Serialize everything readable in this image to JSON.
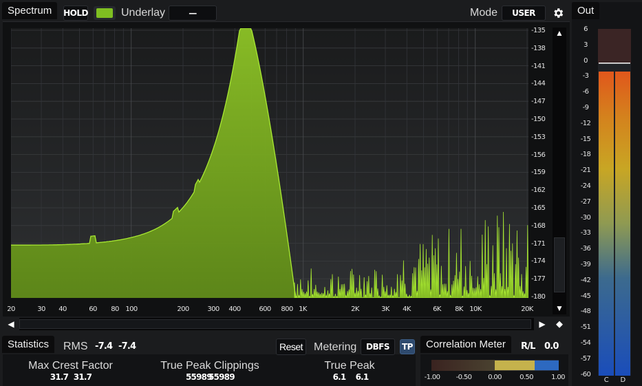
{
  "spectrum": {
    "tab": "Spectrum",
    "hold_label": "HOLD",
    "hold_toggle_color": "#7fbf21",
    "underlay_label": "Underlay",
    "underlay_value": "—",
    "mode_label": "Mode",
    "mode_value": "USER",
    "settings_icon": "gear-icon",
    "y_ticks": [
      "-135",
      "-138",
      "-141",
      "-144",
      "-147",
      "-150",
      "-153",
      "-156",
      "-159",
      "-162",
      "-165",
      "-168",
      "-171",
      "-174",
      "-177",
      "-180"
    ],
    "x_ticks": [
      "20",
      "30",
      "40",
      "60",
      "80",
      "100",
      "200",
      "300",
      "400",
      "600",
      "800",
      "1K",
      "2K",
      "3K",
      "4K",
      "6K",
      "8K",
      "10K",
      "20K"
    ],
    "fill_color": "#7fb521",
    "line_color": "#a8e832"
  },
  "out": {
    "tab": "Out",
    "ticks": [
      "6",
      "3",
      "0",
      "-3",
      "-6",
      "-9",
      "-12",
      "-15",
      "-18",
      "-21",
      "-24",
      "-27",
      "-30",
      "-33",
      "-36",
      "-39",
      "-42",
      "-45",
      "-48",
      "-51",
      "-54",
      "-57",
      "-60"
    ],
    "channels": [
      "C",
      "D"
    ]
  },
  "statistics": {
    "tab": "Statistics",
    "rms_label": "RMS",
    "rms_left": "-7.4",
    "rms_right": "-7.4",
    "reset_label": "Reset",
    "metering_label": "Metering",
    "metering_value": "DBFS",
    "tp_label": "TP",
    "max_crest_label": "Max Crest Factor",
    "max_crest_left": "31.7",
    "max_crest_right": "31.7",
    "clippings_label": "True Peak Clippings",
    "clippings_left": "55989",
    "clippings_right": "55989",
    "true_peak_label": "True Peak",
    "true_peak_left": "6.1",
    "true_peak_right": "6.1"
  },
  "correlation": {
    "tab": "Correlation Meter",
    "mode_label": "R/L",
    "value": "0.0",
    "scale": [
      "-1.00",
      "-0.50",
      "0.00",
      "0.50",
      "1.00"
    ]
  }
}
